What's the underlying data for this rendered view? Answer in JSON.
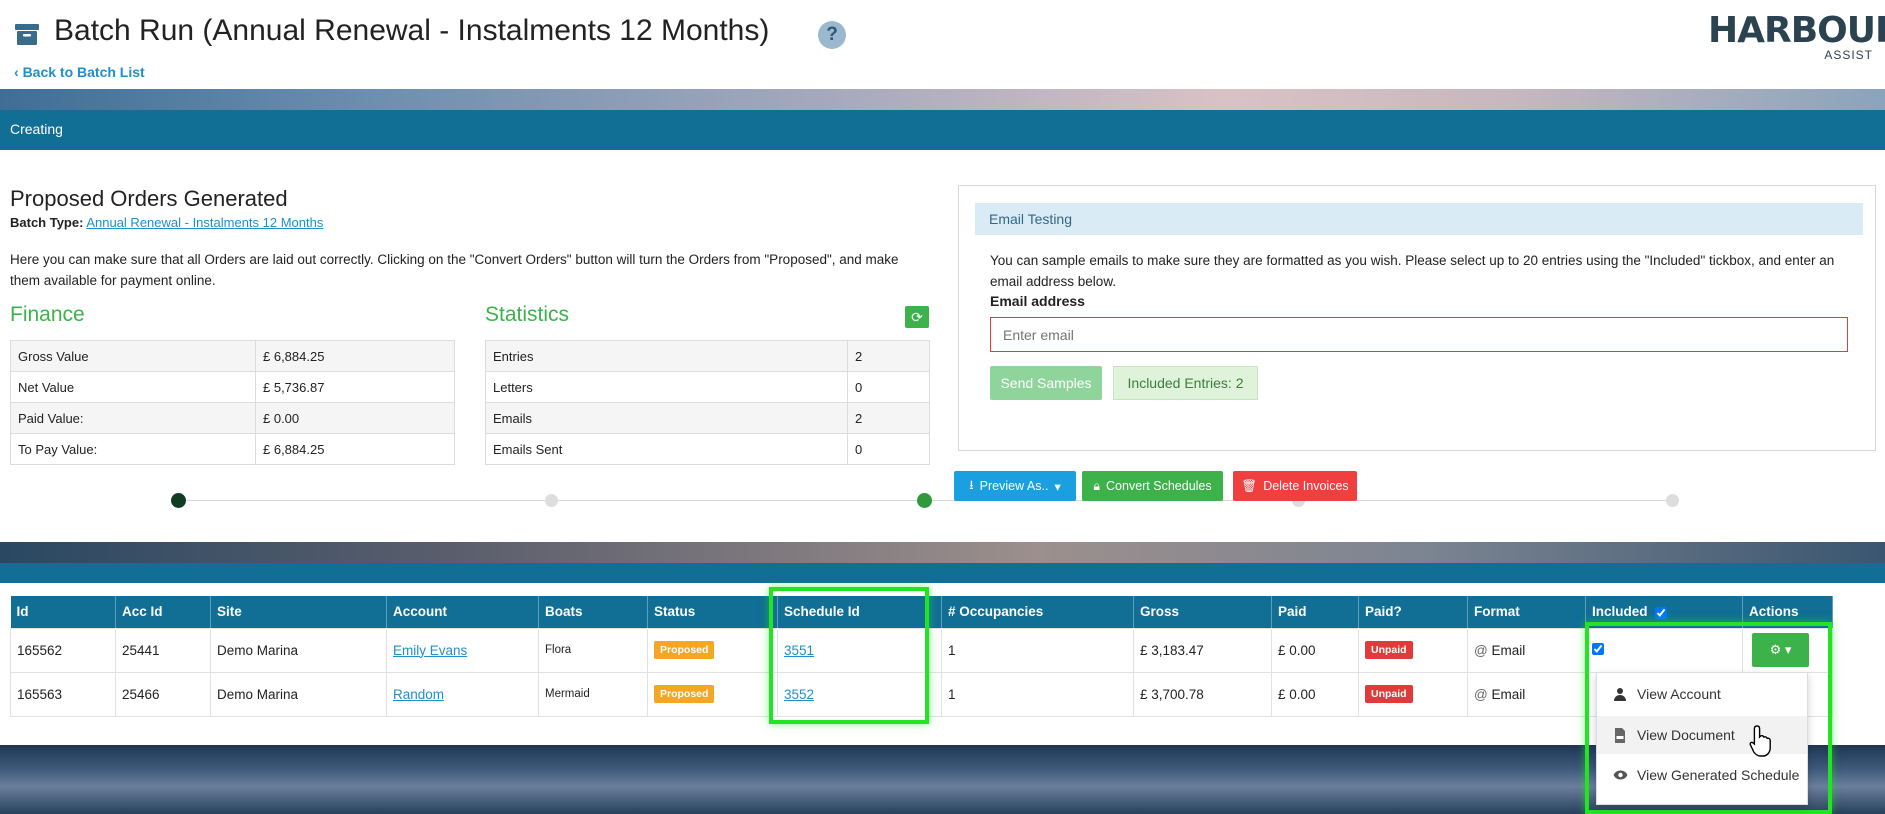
{
  "header": {
    "title": "Batch Run (Annual Renewal - Instalments 12 Months)",
    "back_link": "Back to Batch List",
    "help": "?",
    "logo_main": "HARBOUR",
    "logo_sub": "ASSIST"
  },
  "status_bar": {
    "text": "Creating"
  },
  "card": {
    "title": "Proposed Orders Generated",
    "batch_type_label": "Batch Type:",
    "batch_type_value": "Annual Renewal - Instalments 12 Months",
    "intro": "Here you can make sure that all Orders are laid out correctly. Clicking on the \"Convert Orders\" button will turn the Orders from \"Proposed\", and make them available for payment online."
  },
  "finance": {
    "heading": "Finance",
    "rows": [
      {
        "label": "Gross Value",
        "value": "£ 6,884.25"
      },
      {
        "label": "Net Value",
        "value": "£ 5,736.87"
      },
      {
        "label": "Paid Value:",
        "value": "£ 0.00"
      },
      {
        "label": "To Pay Value:",
        "value": "£ 6,884.25"
      }
    ]
  },
  "statistics": {
    "heading": "Statistics",
    "rows": [
      {
        "label": "Entries",
        "value": "2"
      },
      {
        "label": "Letters",
        "value": "0"
      },
      {
        "label": "Emails",
        "value": "2"
      },
      {
        "label": "Emails Sent",
        "value": "0"
      }
    ]
  },
  "actions": {
    "preview": "Preview As..",
    "convert": "Convert Schedules",
    "delete": "Delete Invoices"
  },
  "email": {
    "heading": "Email Testing",
    "text": "You can sample emails to make sure they are formatted as you wish. Please select up to 20 entries using the \"Included\" tickbox, and enter an email address below.",
    "label": "Email address",
    "placeholder": "Enter email",
    "send": "Send Samples",
    "included": "Included Entries: 2"
  },
  "table": {
    "columns": [
      "Id",
      "Acc Id",
      "Site",
      "Account",
      "Boats",
      "Status",
      "Schedule Id",
      "# Occupancies",
      "Gross",
      "Paid",
      "Paid?",
      "Format",
      "Included",
      "Actions"
    ],
    "rows": [
      {
        "id": "165562",
        "acc_id": "25441",
        "site": "Demo Marina",
        "account": "Emily Evans",
        "boats": "Flora",
        "status": "Proposed",
        "schedule_id": "3551",
        "occupancies": "1",
        "gross": "£ 3,183.47",
        "paid": "£ 0.00",
        "paid_status": "Unpaid",
        "format": "Email",
        "included": true
      },
      {
        "id": "165563",
        "acc_id": "25466",
        "site": "Demo Marina",
        "account": "Random",
        "boats": "Mermaid",
        "status": "Proposed",
        "schedule_id": "3552",
        "occupancies": "1",
        "gross": "£ 3,700.78",
        "paid": "£ 0.00",
        "paid_status": "Unpaid",
        "format": "Email",
        "included": false
      }
    ]
  },
  "dropdown": {
    "items": [
      "View Account",
      "View Document",
      "View Generated Schedule"
    ]
  },
  "colors": {
    "primary": "#116f96",
    "green": "#3db24a",
    "blue": "#1aa0e0",
    "red": "#ef3f3f",
    "orange": "#f5a623",
    "highlight": "#22e422"
  }
}
